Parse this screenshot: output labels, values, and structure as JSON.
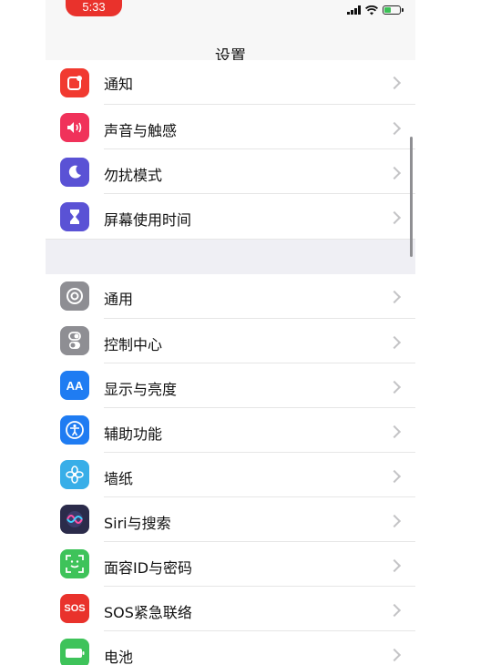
{
  "status": {
    "time": "5:33"
  },
  "nav": {
    "title": "设置"
  },
  "rows": [
    {
      "label": "通知",
      "icon": "notification-icon",
      "color": "#f13a30"
    },
    {
      "label": "声音与触感",
      "icon": "speaker-icon",
      "color": "#f0325a"
    },
    {
      "label": "勿扰模式",
      "icon": "moon-icon",
      "color": "#5a52d5"
    },
    {
      "label": "屏幕使用时间",
      "icon": "hourglass-icon",
      "color": "#5a52d5"
    },
    {
      "label": "通用",
      "icon": "gear-icon",
      "color": "#8e8e93"
    },
    {
      "label": "控制中心",
      "icon": "toggle-icon",
      "color": "#8e8e93"
    },
    {
      "label": "显示与亮度",
      "icon": "aa-icon",
      "color": "#1f7cf2",
      "icon_text": "AA"
    },
    {
      "label": "辅助功能",
      "icon": "accessibility-icon",
      "color": "#1f7cf2"
    },
    {
      "label": "墙纸",
      "icon": "flower-icon",
      "color": "#38aee8"
    },
    {
      "label": "Siri与搜索",
      "icon": "siri-icon",
      "color": "#2b2b4a"
    },
    {
      "label": "面容ID与密码",
      "icon": "face-id-icon",
      "color": "#3ec35a"
    },
    {
      "label": "SOS紧急联络",
      "icon": "sos-icon",
      "color": "#e9322c",
      "icon_text": "SOS"
    },
    {
      "label": "电池",
      "icon": "battery-icon",
      "color": "#3ec35a"
    }
  ]
}
